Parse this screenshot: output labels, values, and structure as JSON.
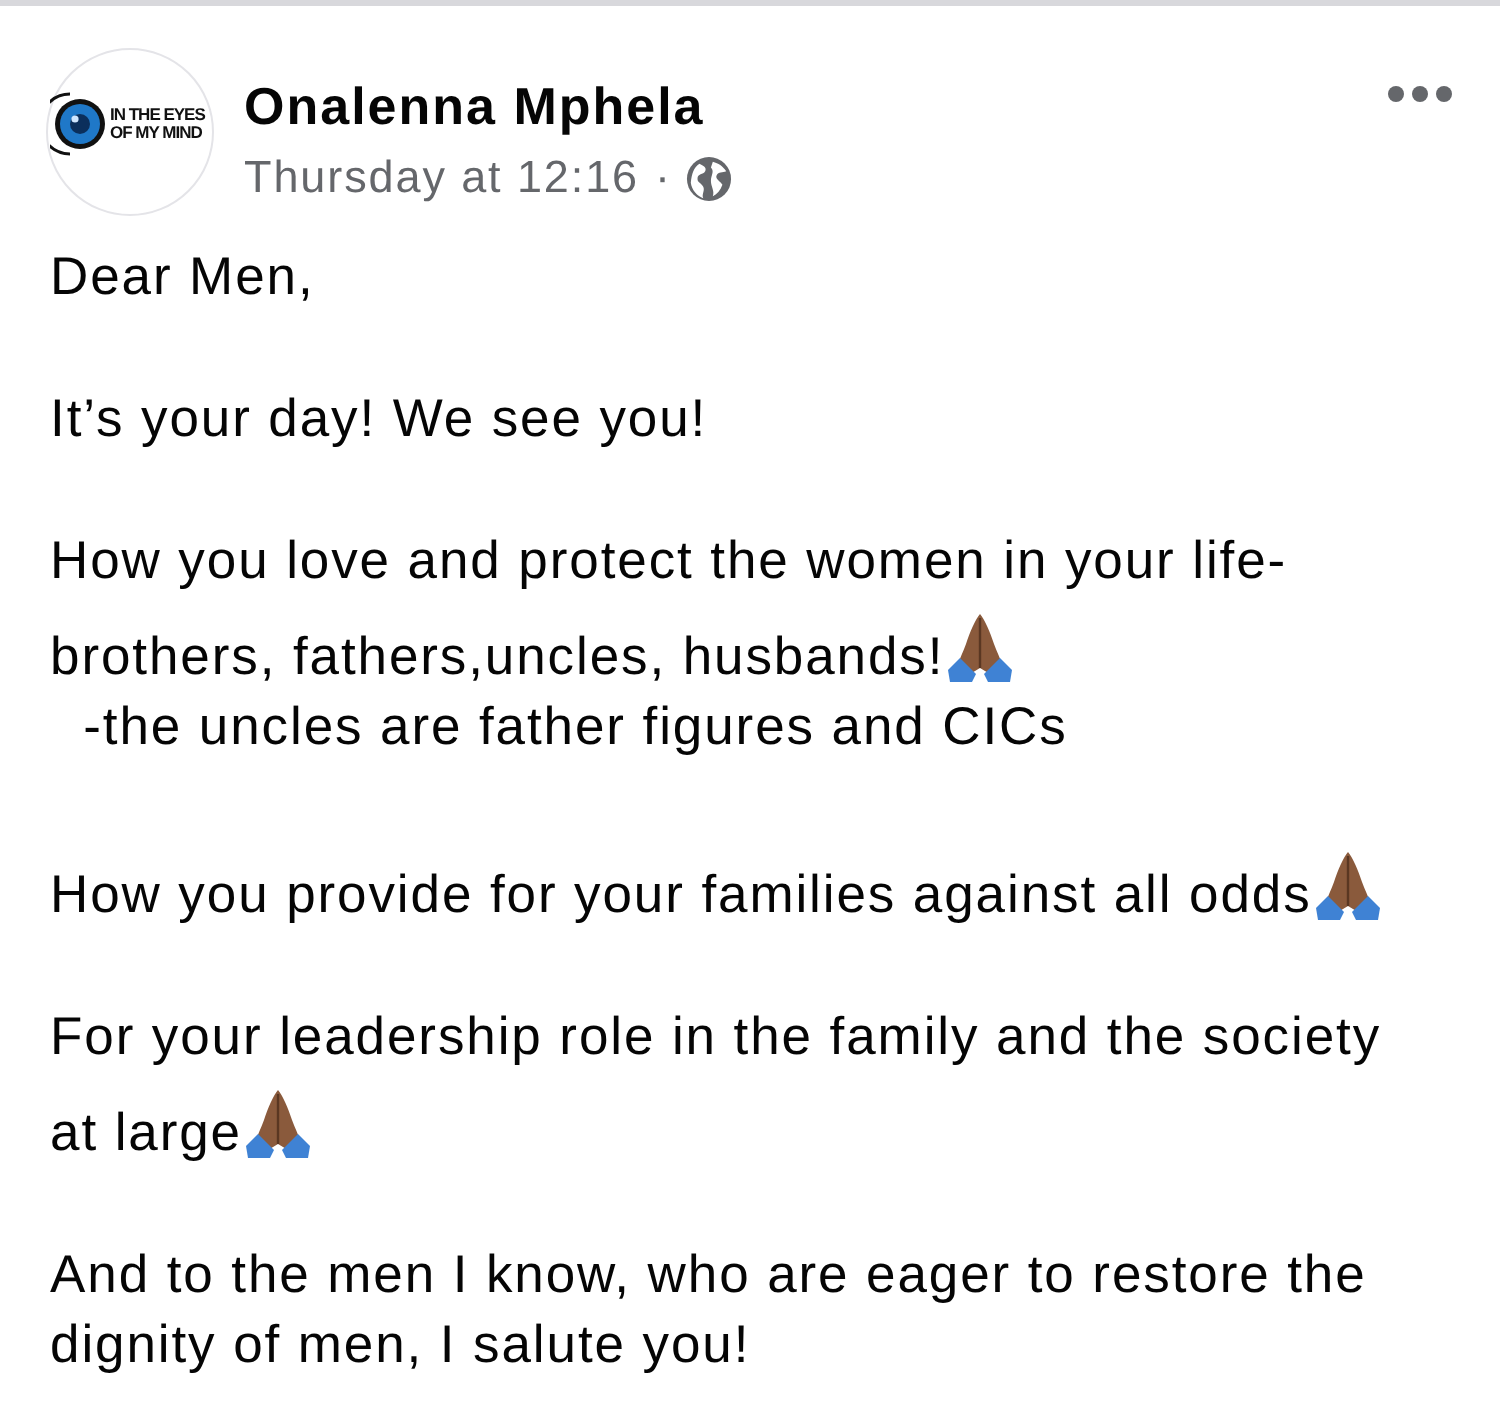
{
  "post": {
    "author": {
      "name": "Onalenna Mphela",
      "avatar": {
        "logo_lines": [
          "IN THE EYES",
          "OF MY MIND"
        ]
      }
    },
    "timestamp": "Thursday at 12:16",
    "separator": "·"
  },
  "body": {
    "paragraphs": [
      {
        "lines": [
          {
            "text": "Dear Men,"
          }
        ]
      },
      {
        "lines": [
          {
            "text": "It’s your day! We see you!"
          }
        ]
      },
      {
        "lines": [
          {
            "text": "How you love and protect the women in your life-"
          },
          {
            "text": "brothers, fathers,uncles, husbands!",
            "trailing_emoji": true
          },
          {
            "text": "  -the uncles are father figures and CICs"
          }
        ]
      },
      {
        "lines": [
          {
            "text": "How you provide for your families against all odds",
            "trailing_emoji": true
          }
        ]
      },
      {
        "lines": [
          {
            "text": "For your leadership role in the family and the society"
          },
          {
            "text": "at large",
            "trailing_emoji": true
          }
        ]
      },
      {
        "lines": [
          {
            "text": "And to the men I know, who are eager to restore the dignity of men, I salute you!"
          }
        ]
      }
    ]
  }
}
